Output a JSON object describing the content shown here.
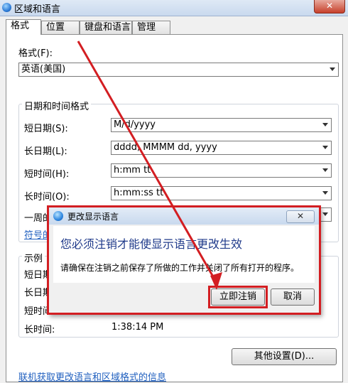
{
  "window": {
    "title": "区域和语言",
    "close_glyph": "✕"
  },
  "tabs": [
    {
      "label": "格式"
    },
    {
      "label": "位置"
    },
    {
      "label": "键盘和语言"
    },
    {
      "label": "管理"
    }
  ],
  "format": {
    "label": "格式(F):",
    "value": "英语(美国)"
  },
  "datetime": {
    "group_label": "日期和时间格式",
    "rows": [
      {
        "label": "短日期(S):",
        "value": "M/d/yyyy"
      },
      {
        "label": "长日期(L):",
        "value": "dddd, MMMM dd, yyyy"
      },
      {
        "label": "短时间(H):",
        "value": "h:mm tt"
      },
      {
        "label": "长时间(O):",
        "value": "h:mm:ss tt"
      },
      {
        "label": "一周的",
        "value": ""
      }
    ],
    "link_partial": "符号的"
  },
  "examples": {
    "group_label": "示例",
    "rows": [
      {
        "label": "短日期",
        "value": ""
      },
      {
        "label": "长日期",
        "value": ""
      },
      {
        "label": "短时间",
        "value": ""
      },
      {
        "label": "长时间:",
        "value": "1:38:14 PM"
      }
    ]
  },
  "other_settings_button": "其他设置(D)...",
  "bottom_link": "联机获取更改语言和区域格式的信息",
  "dialog": {
    "title": "更改显示语言",
    "close_glyph": "✕",
    "main_text": "您必须注销才能使显示语言更改生效",
    "sub_text": "请确保在注销之前保存了所做的工作并关闭了所有打开的程序。",
    "confirm_button": "立即注销",
    "cancel_button": "取消"
  },
  "colors": {
    "annotation_red": "#d31e22",
    "link_blue": "#1f5fbf",
    "dialog_heading": "#1f3a8a"
  }
}
